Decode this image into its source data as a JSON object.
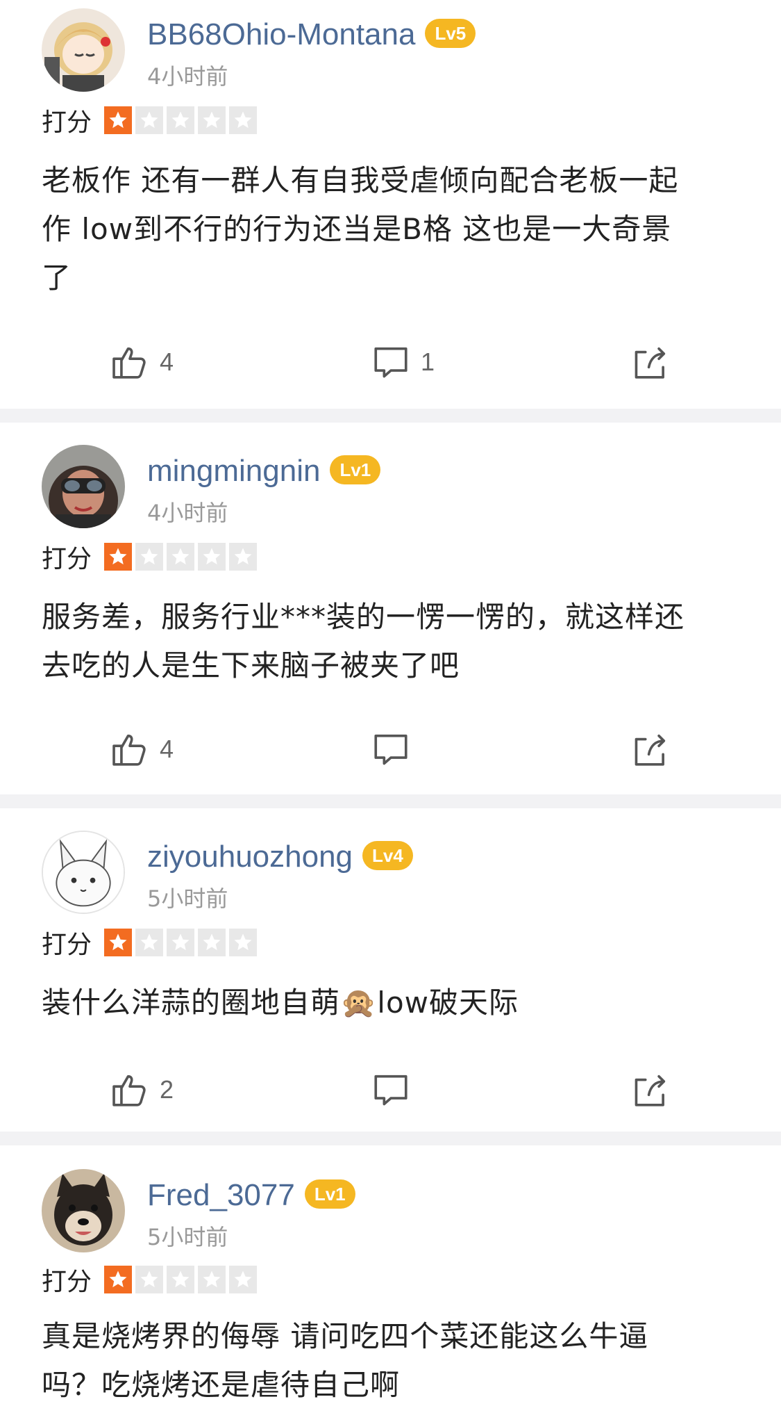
{
  "rating_label": "打分",
  "colors": {
    "username": "#4c6a95",
    "badge": "#f5b722",
    "star_on": "#f36c21",
    "star_off": "#e8e8e8",
    "separator": "#f2f2f4"
  },
  "icons": {
    "like": "thumbs-up-icon",
    "comment": "comment-icon",
    "share": "share-icon"
  },
  "reviews": [
    {
      "username": "BB68Ohio-Montana",
      "level": "Lv5",
      "time": "4小时前",
      "rating": 1,
      "max_rating": 5,
      "content": [
        "老板作 还有一群人有自我受虐倾向配合老板一起",
        "作  low到不行的行为还当是B格  这也是一大奇景",
        "了"
      ],
      "likes": "4",
      "comments": "1"
    },
    {
      "username": "mingmingnin",
      "level": "Lv1",
      "time": "4小时前",
      "rating": 1,
      "max_rating": 5,
      "content": [
        "服务差，服务行业***装的一愣一愣的，就这样还",
        "去吃的人是生下来脑子被夹了吧"
      ],
      "likes": "4",
      "comments": ""
    },
    {
      "username": "ziyouhuozhong",
      "level": "Lv4",
      "time": "5小时前",
      "rating": 1,
      "max_rating": 5,
      "content": [
        "装什么洋蒜的圈地自萌🙊low破天际"
      ],
      "likes": "2",
      "comments": ""
    },
    {
      "username": "Fred_3077",
      "level": "Lv1",
      "time": "5小时前",
      "rating": 1,
      "max_rating": 5,
      "content": [
        "真是烧烤界的侮辱 请问吃四个菜还能这么牛逼",
        "吗？吃烧烤还是虐待自己啊"
      ],
      "likes": "",
      "comments": ""
    }
  ]
}
